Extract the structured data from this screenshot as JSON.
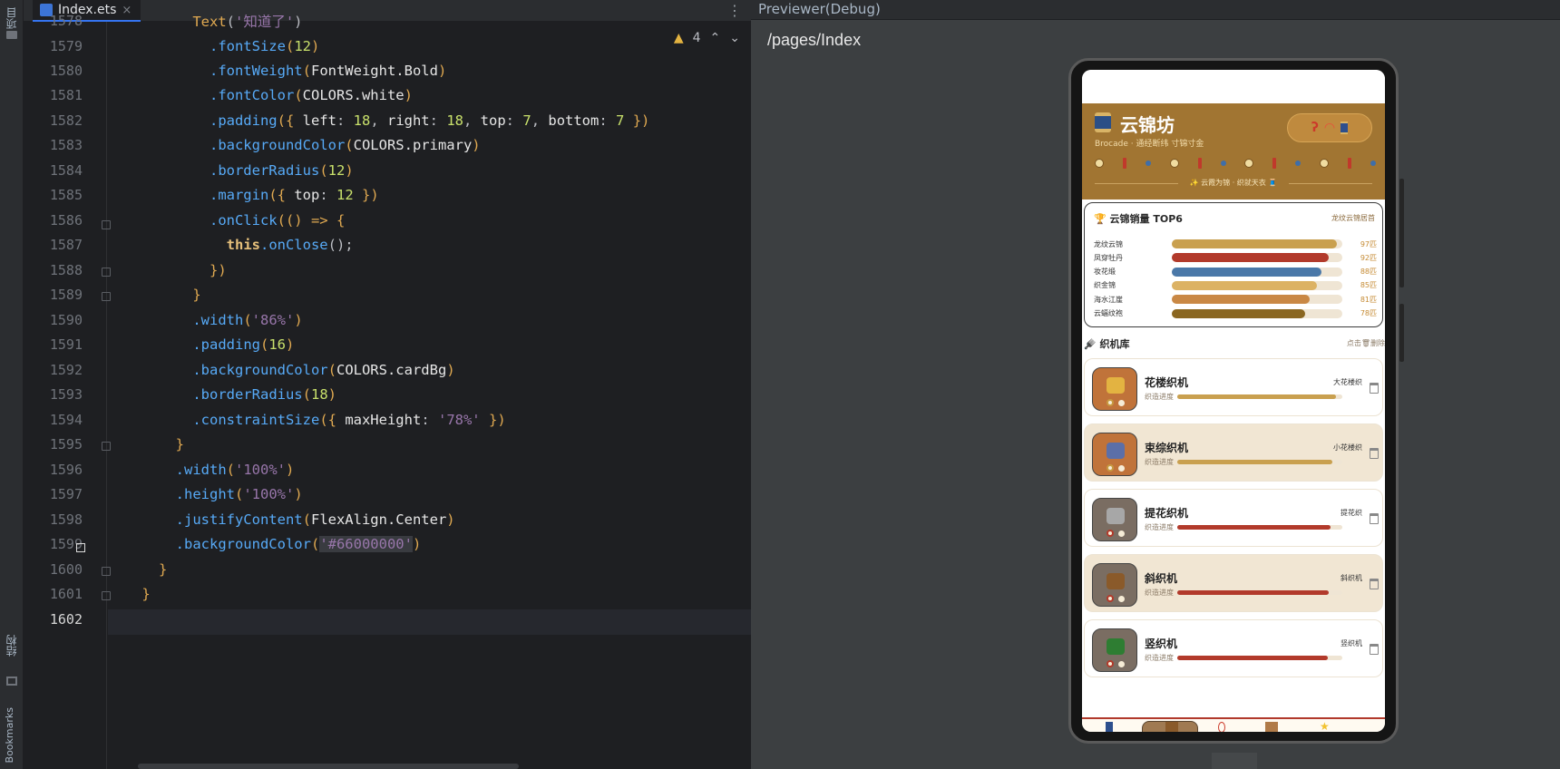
{
  "editor": {
    "tab_label": "Index.ets",
    "tab_close": "×",
    "more_glyph": "⋮",
    "warning_icon": "warning-triangle-icon",
    "warning_count": "4",
    "line_numbers": [
      "1578",
      "1579",
      "1580",
      "1581",
      "1582",
      "1583",
      "1584",
      "1585",
      "1586",
      "1587",
      "1588",
      "1589",
      "1590",
      "1591",
      "1592",
      "1593",
      "1594",
      "1595",
      "1596",
      "1597",
      "1598",
      "1599",
      "1600",
      "1601",
      "1602"
    ],
    "current_line": "1602",
    "sidebar_labels": {
      "project": "项目",
      "structure": "结构",
      "bookmarks": "Bookmarks"
    },
    "code": {
      "l1578": {
        "indent": "          ",
        "call": "Text",
        "arg": "'知道了'"
      },
      "l1579": {
        "indent": "            ",
        "method": ".fontSize",
        "arg": "12"
      },
      "l1580": {
        "indent": "            ",
        "method": ".fontWeight",
        "arg": "FontWeight.Bold"
      },
      "l1581": {
        "indent": "            ",
        "method": ".fontColor",
        "arg": "COLORS.white"
      },
      "l1582": {
        "indent": "            ",
        "method": ".padding",
        "open": "({ ",
        "k1": "left",
        "v1": "18",
        "k2": "right",
        "v2": "18",
        "k3": "top",
        "v3": "7",
        "k4": "bottom",
        "v4": "7",
        "close": " })"
      },
      "l1583": {
        "indent": "            ",
        "method": ".backgroundColor",
        "arg": "COLORS.primary"
      },
      "l1584": {
        "indent": "            ",
        "method": ".borderRadius",
        "arg": "12"
      },
      "l1585": {
        "indent": "            ",
        "method": ".margin",
        "open": "({ ",
        "k1": "top",
        "v1": "12",
        "close": " })"
      },
      "l1586": {
        "indent": "            ",
        "method": ".onClick",
        "tail": "(() => {"
      },
      "l1587": {
        "indent": "              ",
        "this": "this",
        "call": ".onClose",
        "tail": "();"
      },
      "l1588": {
        "indent": "            ",
        "tail": "})"
      },
      "l1589": {
        "indent": "          ",
        "tail": "}"
      },
      "l1590": {
        "indent": "          ",
        "method": ".width",
        "arg": "'86%'"
      },
      "l1591": {
        "indent": "          ",
        "method": ".padding",
        "arg": "16"
      },
      "l1592": {
        "indent": "          ",
        "method": ".backgroundColor",
        "arg": "COLORS.cardBg"
      },
      "l1593": {
        "indent": "          ",
        "method": ".borderRadius",
        "arg": "18"
      },
      "l1594": {
        "indent": "          ",
        "method": ".constraintSize",
        "open": "({ ",
        "k1": "maxHeight",
        "v1": "'78%'",
        "close": " })"
      },
      "l1595": {
        "indent": "        ",
        "tail": "}"
      },
      "l1596": {
        "indent": "        ",
        "method": ".width",
        "arg": "'100%'"
      },
      "l1597": {
        "indent": "        ",
        "method": ".height",
        "arg": "'100%'"
      },
      "l1598": {
        "indent": "        ",
        "method": ".justifyContent",
        "arg": "FlexAlign.Center"
      },
      "l1599": {
        "indent": "        ",
        "method": ".backgroundColor",
        "arg": "'#66000000'"
      },
      "l1600": {
        "indent": "      ",
        "tail": "}"
      },
      "l1601": {
        "indent": "    ",
        "tail": "}"
      }
    }
  },
  "previewer": {
    "title": "Previewer(Debug)",
    "route": "/pages/Index"
  },
  "app": {
    "hero": {
      "title": "云锦坊",
      "subtitle": "Brocade · 通经断纬 寸锦寸金",
      "motto": "✨ 云霞为锦 · 织就天衣 🧵"
    },
    "rank": {
      "title": "🏆 云锦销量 TOP6",
      "link": "龙纹云锦居首",
      "items": [
        {
          "name": "龙纹云锦",
          "value": 97,
          "label": "97匹",
          "color": "#c9a04f"
        },
        {
          "name": "凤穿牡丹",
          "value": 92,
          "label": "92匹",
          "color": "#b23a2b"
        },
        {
          "name": "妆花缎",
          "value": 88,
          "label": "88匹",
          "color": "#4a78a8"
        },
        {
          "name": "织金锦",
          "value": 85,
          "label": "85匹",
          "color": "#dcb264"
        },
        {
          "name": "海水江崖",
          "value": 81,
          "label": "81匹",
          "color": "#c98845"
        },
        {
          "name": "云蝠纹袍",
          "value": 78,
          "label": "78匹",
          "color": "#8a6620"
        }
      ]
    },
    "library": {
      "title": "🪮 织机库",
      "hint": "点击🗑删除",
      "looms": [
        {
          "name": "花楼织机",
          "pattern": "大花楼织",
          "tag": "织造进度",
          "progress": 0.96,
          "bg": "#ffffff",
          "thumb": "#c0733a",
          "emoji": "#e3b341",
          "fill": "#c9a04f",
          "icon": "loom-icon"
        },
        {
          "name": "束综织机",
          "pattern": "小花楼织",
          "tag": "织造进度",
          "progress": 0.94,
          "bg": "#f1e6d3",
          "thumb": "#c0733a",
          "emoji": "#5b6fa8",
          "fill": "#c9a04f",
          "icon": "loom-icon"
        },
        {
          "name": "提花织机",
          "pattern": "提花织",
          "tag": "织造进度",
          "progress": 0.93,
          "bg": "#ffffff",
          "thumb": "#7a6d62",
          "emoji": "#a7a7a7",
          "fill": "#b23a2b",
          "icon": "gear-icon"
        },
        {
          "name": "斜织机",
          "pattern": "斜织机",
          "tag": "织造进度",
          "progress": 0.92,
          "bg": "#f1e6d3",
          "thumb": "#7a6d62",
          "emoji": "#8a5a2a",
          "fill": "#b23a2b",
          "icon": "acorn-icon"
        },
        {
          "name": "竖织机",
          "pattern": "竖织机",
          "tag": "织造进度",
          "progress": 0.91,
          "bg": "#ffffff",
          "thumb": "#7a6d62",
          "emoji": "#2e7d32",
          "fill": "#b23a2b",
          "icon": "tree-icon"
        }
      ]
    },
    "nav": {
      "icons": [
        "spool-icon",
        "loom-icon",
        "thread-icon",
        "box-icon",
        "star-icon"
      ],
      "selected": 1
    }
  }
}
